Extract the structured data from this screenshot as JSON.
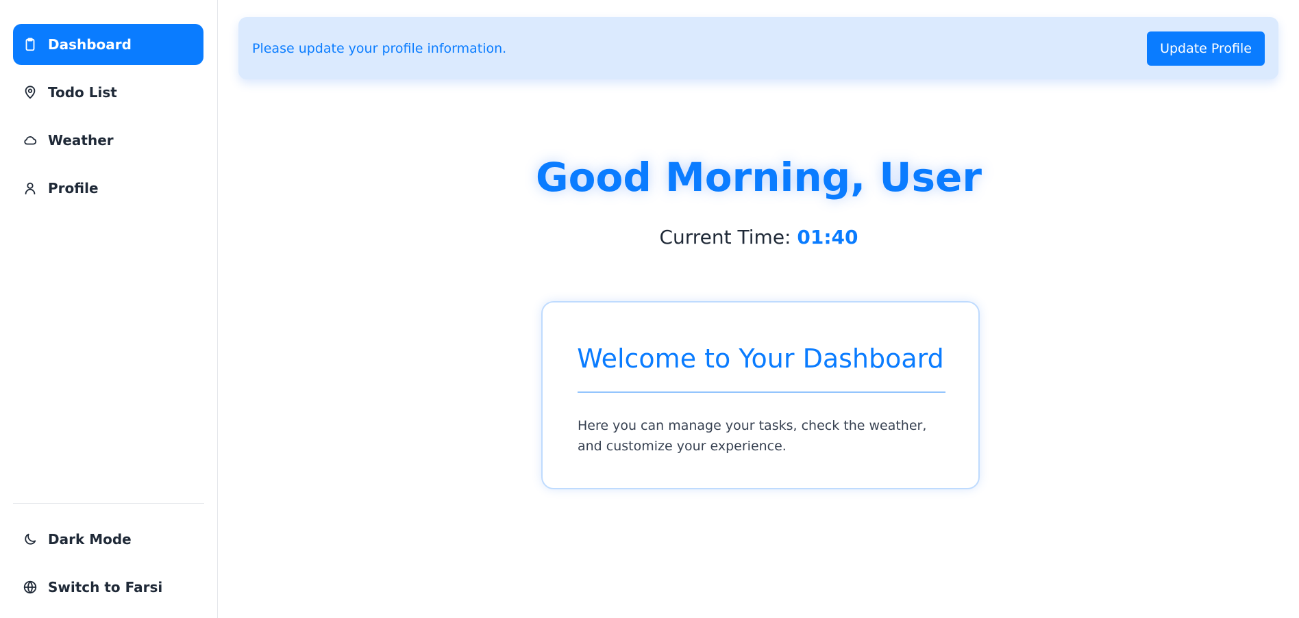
{
  "sidebar": {
    "items": [
      {
        "label": "Dashboard",
        "icon": "clipboard-icon",
        "active": true
      },
      {
        "label": "Todo List",
        "icon": "map-pin-icon",
        "active": false
      },
      {
        "label": "Weather",
        "icon": "cloud-icon",
        "active": false
      },
      {
        "label": "Profile",
        "icon": "user-icon",
        "active": false
      }
    ],
    "bottom_items": [
      {
        "label": "Dark Mode",
        "icon": "moon-icon"
      },
      {
        "label": "Switch to Farsi",
        "icon": "globe-icon"
      }
    ]
  },
  "banner": {
    "message": "Please update your profile information.",
    "button_label": "Update Profile"
  },
  "greeting": {
    "text": "Good Morning, User",
    "time_label": "Current Time:",
    "time_value": "01:40"
  },
  "card": {
    "title": "Welcome to Your Dashboard",
    "text": "Here you can manage your tasks, check the weather, and customize your experience."
  },
  "colors": {
    "accent": "#0a7cff",
    "banner_bg": "#dbeafe",
    "card_border": "#bfdbfe"
  }
}
